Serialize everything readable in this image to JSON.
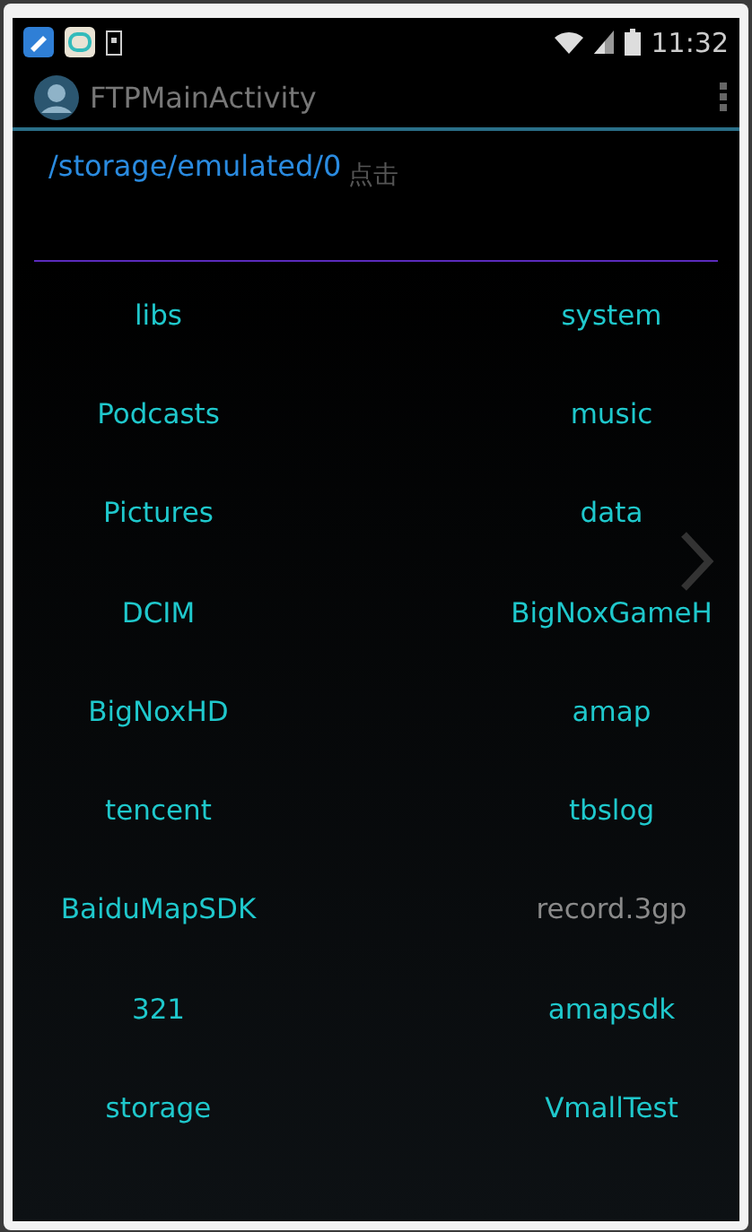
{
  "status_bar": {
    "time": "11:32"
  },
  "action_bar": {
    "title": "FTPMainActivity"
  },
  "path": "/storage/emulated/0",
  "hint": "点击",
  "files": [
    {
      "name": "libs",
      "kind": "folder"
    },
    {
      "name": "system",
      "kind": "folder"
    },
    {
      "name": "Podcasts",
      "kind": "folder"
    },
    {
      "name": "music",
      "kind": "folder"
    },
    {
      "name": "Pictures",
      "kind": "folder"
    },
    {
      "name": "data",
      "kind": "folder"
    },
    {
      "name": "DCIM",
      "kind": "folder"
    },
    {
      "name": "BigNoxGameH",
      "kind": "folder"
    },
    {
      "name": "BigNoxHD",
      "kind": "folder"
    },
    {
      "name": "amap",
      "kind": "folder"
    },
    {
      "name": "tencent",
      "kind": "folder"
    },
    {
      "name": "tbslog",
      "kind": "folder"
    },
    {
      "name": "BaiduMapSDK",
      "kind": "folder"
    },
    {
      "name": "record.3gp",
      "kind": "file"
    },
    {
      "name": "321",
      "kind": "folder"
    },
    {
      "name": "amapsdk",
      "kind": "folder"
    },
    {
      "name": "storage",
      "kind": "folder"
    },
    {
      "name": "VmallTest",
      "kind": "folder"
    }
  ]
}
